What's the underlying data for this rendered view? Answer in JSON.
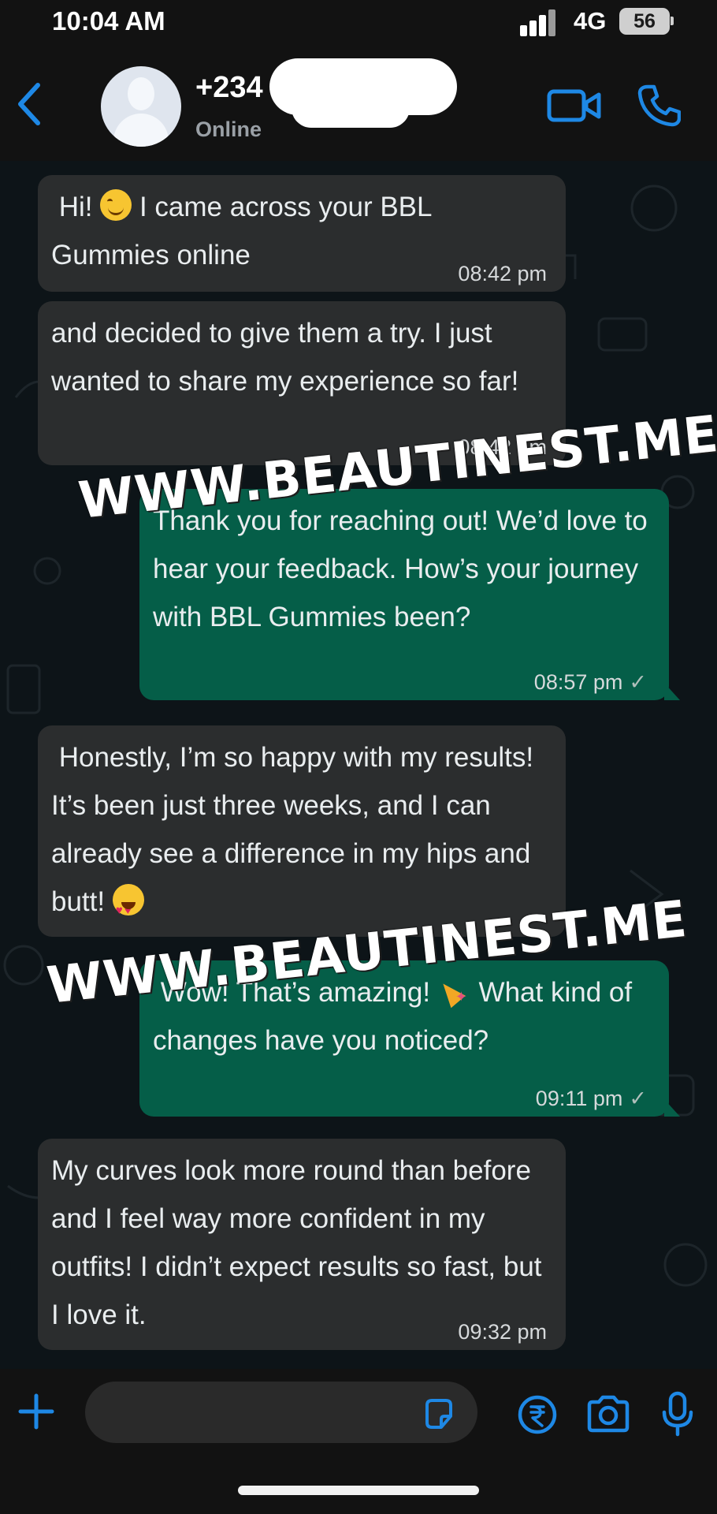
{
  "status_bar": {
    "time": "10:04 AM",
    "network": "4G",
    "battery": "56"
  },
  "header": {
    "contact_name": "+234",
    "status": "Online"
  },
  "messages": [
    {
      "direction": "incoming",
      "text": "Hi! 😊 I came across your BBL Gummies online",
      "time": "08:42 pm"
    },
    {
      "direction": "incoming",
      "text": " and decided to give them a try. I just wanted to share my experience so far!",
      "time": "08:42 pm"
    },
    {
      "direction": "outgoing",
      "text": " Thank you for reaching out! We’d love to hear your feedback. How’s your journey with BBL Gummies been?",
      "time": "08:57 pm",
      "status": "sent"
    },
    {
      "direction": "incoming",
      "text": " Honestly, I’m so happy with my results! It’s been just three weeks, and I can already see a difference in my hips and butt! 😍",
      "time": ""
    },
    {
      "direction": "outgoing",
      "text": " Wow! That’s amazing! 🎉 What kind of changes have you noticed?",
      "time": "09:11 pm",
      "status": "sent"
    },
    {
      "direction": "incoming",
      "text": " My curves look more round than before and I feel way more confident in my outfits! I didn’t expect results so fast, but I love it.",
      "time": "09:32 pm"
    }
  ],
  "watermarks": [
    "WWW.BEAUTINEST.ME",
    "WWW.BEAUTINEST.ME"
  ],
  "colors": {
    "incoming_bubble": "#2b2d2e",
    "outgoing_bubble": "#055e48",
    "accent_icons": "#1e88e5",
    "background": "#0d1418"
  },
  "icons": [
    "back-arrow-icon",
    "avatar-icon",
    "video-call-icon",
    "phone-icon",
    "plus-icon",
    "sticker-icon",
    "payment-icon",
    "camera-icon",
    "microphone-icon"
  ]
}
